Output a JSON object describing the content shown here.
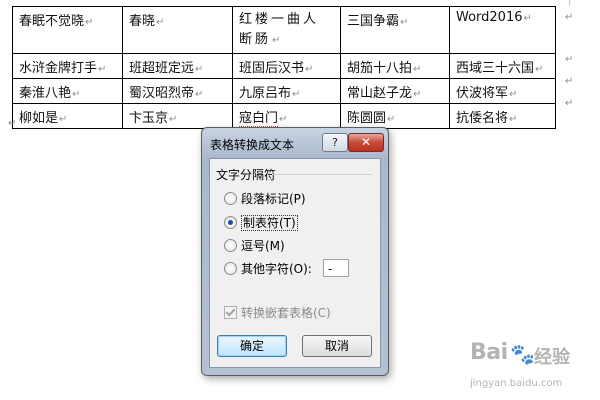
{
  "table": {
    "rows": [
      [
        "春眠不觉晓",
        "春晓",
        "红楼一曲人断肠",
        "三国争霸",
        "Word2016"
      ],
      [
        "水浒金牌打手",
        "班超班定远",
        "班固后汉书",
        "胡笳十八拍",
        "西域三十六国"
      ],
      [
        "秦淮八艳",
        "蜀汉昭烈帝",
        "九原吕布",
        "常山赵子龙",
        "伏波将军"
      ],
      [
        "柳如是",
        "卞玉京",
        "寇白门",
        "陈圆圆",
        "抗倭名将"
      ]
    ],
    "cell_mark": "↵",
    "paragraph_mark": "↵"
  },
  "dialog": {
    "title": "表格转换成文本",
    "help_label": "?",
    "close_label": "✕",
    "group_label": "文字分隔符",
    "options": [
      {
        "label": "段落标记(P)",
        "checked": false
      },
      {
        "label": "制表符(T)",
        "checked": true
      },
      {
        "label": "逗号(M)",
        "checked": false
      },
      {
        "label": "其他字符(O):",
        "checked": false
      }
    ],
    "other_char_value": "-",
    "nested_checkbox": {
      "label": "转换嵌套表格(C)",
      "checked": true,
      "disabled": true
    },
    "ok_label": "确定",
    "cancel_label": "取消"
  },
  "watermark": {
    "logo": "Bai",
    "logo_cn": "经验",
    "url": "jingyan.baidu.com"
  }
}
